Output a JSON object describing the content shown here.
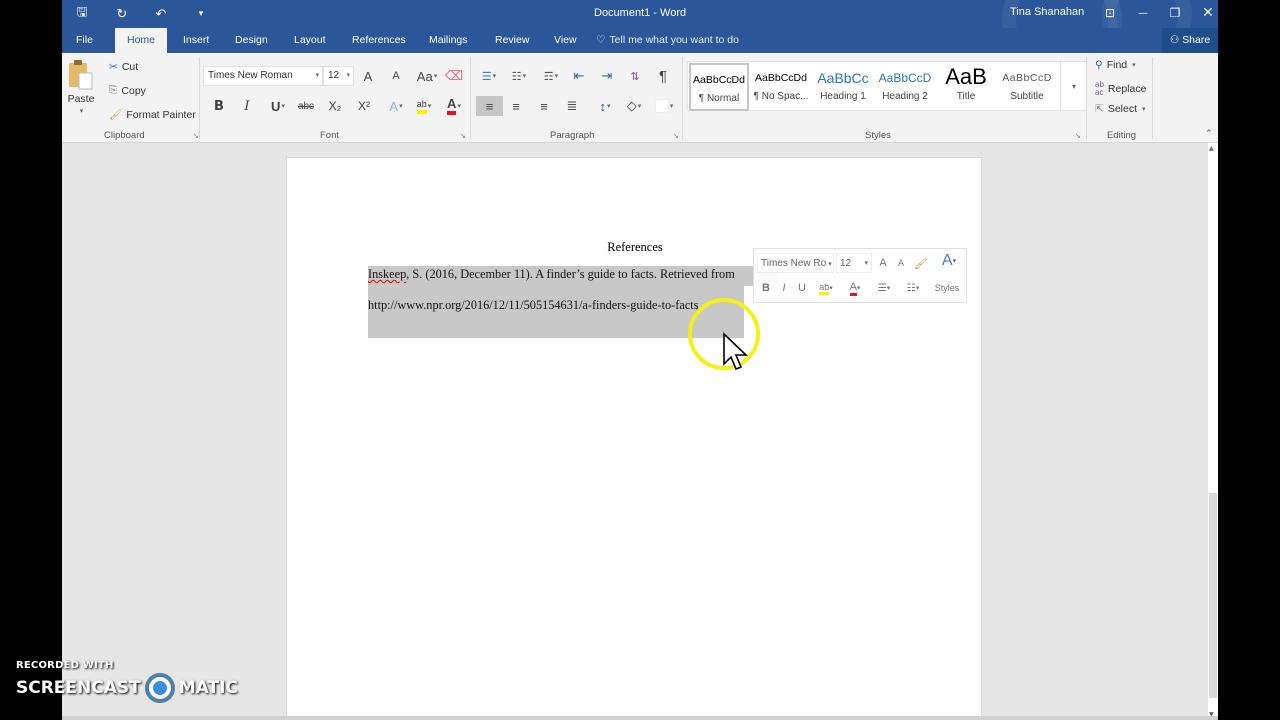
{
  "window": {
    "doc_title": "Document1  -  Word",
    "user_name": "Tina Shanahan",
    "qat": [
      {
        "name": "save-icon",
        "glyph": "🖫"
      },
      {
        "name": "redo-icon",
        "glyph": "↻"
      },
      {
        "name": "undo-icon",
        "glyph": "↶"
      },
      {
        "name": "customize-qat-icon",
        "glyph": "▾"
      }
    ],
    "controls": {
      "ribbon_display": "⊡",
      "minimize": "—",
      "restore": "❐",
      "close": "✕"
    }
  },
  "tabs": [
    {
      "label": "File"
    },
    {
      "label": "Home",
      "active": true
    },
    {
      "label": "Insert"
    },
    {
      "label": "Design"
    },
    {
      "label": "Layout"
    },
    {
      "label": "References"
    },
    {
      "label": "Mailings"
    },
    {
      "label": "Review"
    },
    {
      "label": "View"
    }
  ],
  "tell_me": "Tell me what you want to do",
  "share_label": "Share",
  "ribbon": {
    "clipboard": {
      "label": "Clipboard",
      "paste": "Paste",
      "cut": "Cut",
      "copy": "Copy",
      "format_painter": "Format Painter"
    },
    "font": {
      "label": "Font",
      "font_name": "Times New Roman",
      "font_size": "12",
      "grow": "A",
      "shrink": "A",
      "change_case": "Aa",
      "bold": "B",
      "italic": "I",
      "underline": "U",
      "strikethrough": "abc",
      "subscript": "X₂",
      "superscript": "X²",
      "text_effects": "A",
      "highlight": "ab",
      "font_color": "A",
      "highlight_color": "#fff200",
      "font_color_value": "#e81123"
    },
    "paragraph": {
      "label": "Paragraph",
      "pilcrow": "¶"
    },
    "styles": {
      "label": "Styles",
      "items": [
        {
          "preview": "AaBbCcDd",
          "label": "¶ Normal",
          "selected": true
        },
        {
          "preview": "AaBbCcDd",
          "label": "¶ No Spac..."
        },
        {
          "preview": "AaBbCc",
          "label": "Heading 1"
        },
        {
          "preview": "AaBbCcD",
          "label": "Heading 2"
        },
        {
          "preview": "AaB",
          "label": "Title"
        },
        {
          "preview": "AaBbCcD",
          "label": "Subtitle"
        }
      ]
    },
    "editing": {
      "label": "Editing",
      "find": "Find",
      "replace": "Replace",
      "select": "Select"
    }
  },
  "document": {
    "heading": "References",
    "line1_author": "Inskeep",
    "line1_rest": ", S. (2016, December 11). A finder’s guide to facts. Retrieved from",
    "line2": "http://www.npr.org/2016/12/11/505154631/a-finders-guide-to-facts"
  },
  "mini_toolbar": {
    "font_name": "Times New Ro",
    "font_size": "12",
    "bold": "B",
    "italic": "I",
    "underline": "U",
    "styles": "Styles"
  },
  "watermark": {
    "line1": "RECORDED WITH",
    "left": "SCREENCAST",
    "right": "MATIC"
  }
}
